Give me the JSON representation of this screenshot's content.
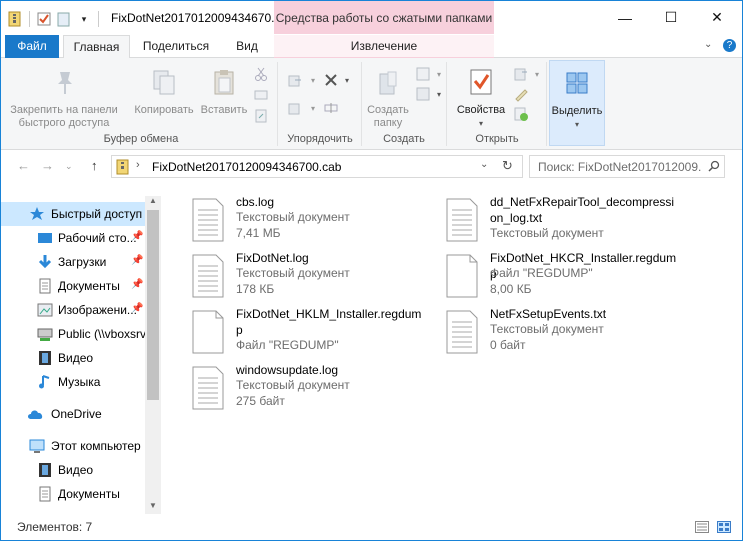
{
  "window": {
    "title": "FixDotNet2017012009434670...",
    "context_tab_header": "Средства работы со сжатыми папками",
    "minimize_glyph": "—",
    "maximize_glyph": "☐",
    "close_glyph": "✕"
  },
  "tabs": {
    "file": "Файл",
    "home": "Главная",
    "share": "Поделиться",
    "view": "Вид",
    "extract": "Извлечение"
  },
  "ribbon": {
    "pin_quick": "Закрепить на панели быстрого доступа",
    "copy": "Копировать",
    "paste": "Вставить",
    "clipboard_group": "Буфер обмена",
    "organize_group": "Упорядочить",
    "new_folder": "Создать папку",
    "create_group": "Создать",
    "properties": "Свойства",
    "open_group": "Открыть",
    "select": "Выделить"
  },
  "address": {
    "path": "FixDotNet20170120094346700.cab",
    "search_placeholder": "Поиск: FixDotNet2017012009..."
  },
  "nav": {
    "items": [
      {
        "label": "Быстрый доступ"
      },
      {
        "label": "Рабочий сто..."
      },
      {
        "label": "Загрузки"
      },
      {
        "label": "Документы"
      },
      {
        "label": "Изображени..."
      },
      {
        "label": "Public (\\\\vboxsrv"
      },
      {
        "label": "Видео"
      },
      {
        "label": "Музыка"
      },
      {
        "label": "OneDrive"
      },
      {
        "label": "Этот компьютер"
      },
      {
        "label": "Видео"
      },
      {
        "label": "Документы"
      }
    ]
  },
  "files": [
    {
      "name": "cbs.log",
      "type": "Текстовый документ",
      "size": "7,41 МБ"
    },
    {
      "name": "dd_NetFxRepairTool_decompression_log.txt",
      "type": "Текстовый документ",
      "size": ""
    },
    {
      "name": "FixDotNet.log",
      "type": "Текстовый документ",
      "size": "178 КБ"
    },
    {
      "name": "FixDotNet_HKCR_Installer.regdump",
      "type": "Файл \"REGDUMP\"",
      "size": "8,00 КБ"
    },
    {
      "name": "FixDotNet_HKLM_Installer.regdump",
      "type": "Файл \"REGDUMP\"",
      "size": ""
    },
    {
      "name": "NetFxSetupEvents.txt",
      "type": "Текстовый документ",
      "size": "0 байт"
    },
    {
      "name": "windowsupdate.log",
      "type": "Текстовый документ",
      "size": "275 байт"
    }
  ],
  "status": {
    "items_count": "Элементов: 7"
  },
  "colors": {
    "accent": "#1979ca",
    "context_tab": "#f7d0dc",
    "selected_nav": "#cce8ff"
  }
}
